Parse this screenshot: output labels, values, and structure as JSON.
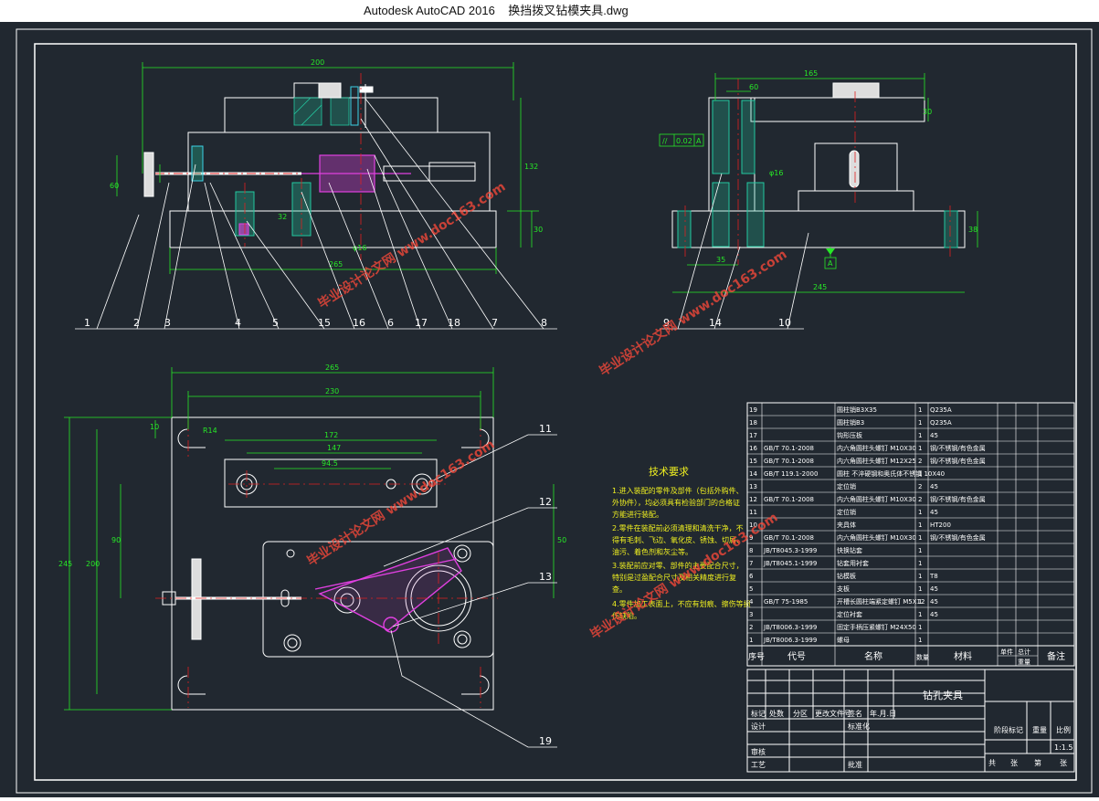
{
  "window": {
    "title": "Autodesk AutoCAD 2016    换挡拨叉钻模夹具.dwg"
  },
  "front_view": {
    "dims": {
      "overall_width": "200",
      "base_width": "265",
      "height": "132",
      "d1": "60",
      "d2": "32",
      "phi": "φ16",
      "v1": "30"
    },
    "balloons": [
      "1",
      "2",
      "3",
      "4",
      "5",
      "15",
      "16",
      "6",
      "17",
      "18",
      "7",
      "8"
    ]
  },
  "side_view": {
    "dims": {
      "width": "165",
      "base": "245",
      "h1": "38",
      "h2": "30",
      "d": "35",
      "e": "60",
      "phi": "φ16"
    },
    "tolerance_frame": {
      "symbol": "//",
      "value": "0.02",
      "datum": "A"
    },
    "datum_label": "A",
    "balloons": [
      "9",
      "14",
      "10"
    ]
  },
  "top_view": {
    "dims": {
      "w265": "265",
      "w230": "230",
      "w172": "172",
      "w147": "147",
      "w94": "94.5",
      "h245": "245",
      "h200": "200",
      "h90": "90",
      "h50": "50",
      "r10": "10",
      "r14": "R14"
    },
    "balloons": [
      "11",
      "12",
      "13",
      "19"
    ]
  },
  "tech_requirements": {
    "title": "技术要求",
    "lines": [
      "1.进入装配的零件及部件（包括外购件、",
      "外协件），均必须具有检验部门的合格证",
      "方能进行装配。",
      "2.零件在装配前必须清理和清洗干净，不",
      "得有毛刺、飞边、氧化皮、锈蚀、切屑、",
      "油污、着色剂和灰尘等。",
      "3.装配前应对零、部件的主要配合尺寸，",
      "特别是过盈配合尺寸及相关精度进行复",
      "查。",
      "4.零件加工表面上，不应有划痕、擦伤等损",
      "伤缺陷。"
    ]
  },
  "bom": {
    "rows": [
      {
        "no": "19",
        "code": "",
        "name": "圆柱销B3X35",
        "qty": "1",
        "material": "Q235A",
        "remark": ""
      },
      {
        "no": "18",
        "code": "",
        "name": "圆柱销B3",
        "qty": "1",
        "material": "Q235A",
        "remark": ""
      },
      {
        "no": "17",
        "code": "",
        "name": "钩形压板",
        "qty": "1",
        "material": "45",
        "remark": ""
      },
      {
        "no": "16",
        "code": "GB/T 70.1-2008",
        "name": "内六角圆柱头螺钉 M10X30",
        "qty": "1",
        "material": "钢/不锈钢/有色金属",
        "remark": ""
      },
      {
        "no": "15",
        "code": "GB/T 70.1-2008",
        "name": "内六角圆柱头螺钉 M12X25",
        "qty": "2",
        "material": "钢/不锈钢/有色金属",
        "remark": ""
      },
      {
        "no": "14",
        "code": "GB/T 119.1-2000",
        "name": "圆柱 不淬硬钢和奥氏体不锈钢 10X40",
        "qty": "1",
        "material": "",
        "remark": ""
      },
      {
        "no": "13",
        "code": "",
        "name": "定位销",
        "qty": "2",
        "material": "45",
        "remark": ""
      },
      {
        "no": "12",
        "code": "GB/T 70.1-2008",
        "name": "内六角圆柱头螺钉 M10X30",
        "qty": "2",
        "material": "钢/不锈钢/有色金属",
        "remark": ""
      },
      {
        "no": "11",
        "code": "",
        "name": "定位销",
        "qty": "1",
        "material": "45",
        "remark": ""
      },
      {
        "no": "10",
        "code": "",
        "name": "夹具体",
        "qty": "1",
        "material": "HT200",
        "remark": ""
      },
      {
        "no": "9",
        "code": "GB/T 70.1-2008",
        "name": "内六角圆柱头螺钉 M10X30",
        "qty": "1",
        "material": "钢/不锈钢/有色金属",
        "remark": ""
      },
      {
        "no": "8",
        "code": "JB/T8045.3-1999",
        "name": "快换钻套",
        "qty": "1",
        "material": "",
        "remark": ""
      },
      {
        "no": "7",
        "code": "JB/T8045.1-1999",
        "name": "钻套用衬套",
        "qty": "1",
        "material": "",
        "remark": ""
      },
      {
        "no": "6",
        "code": "",
        "name": "钻模板",
        "qty": "1",
        "material": "T8",
        "remark": ""
      },
      {
        "no": "5",
        "code": "",
        "name": "支板",
        "qty": "1",
        "material": "45",
        "remark": ""
      },
      {
        "no": "4",
        "code": "GB/T 75-1985",
        "name": "开槽长圆柱端紧定螺钉 M5X12",
        "qty": "1",
        "material": "45",
        "remark": ""
      },
      {
        "no": "3",
        "code": "",
        "name": "定位衬套",
        "qty": "1",
        "material": "45",
        "remark": ""
      },
      {
        "no": "2",
        "code": "JB/T8006.3-1999",
        "name": "固定手柄压紧螺钉 M24X50",
        "qty": "1",
        "material": "",
        "remark": ""
      },
      {
        "no": "1",
        "code": "JB/T8006.3-1999",
        "name": "螺母",
        "qty": "1",
        "material": "",
        "remark": ""
      }
    ],
    "header": {
      "no": "序号",
      "code": "代号",
      "name": "名称",
      "qty": "数量",
      "material": "材料",
      "unit_wt": "单件",
      "total_wt": "总计",
      "weight": "重量",
      "remark": "备注"
    }
  },
  "title_block": {
    "drawing_name": "钻孔夹具",
    "labels": {
      "mark": "标记",
      "count": "处数",
      "zone": "分区",
      "change_doc": "更改文件号",
      "sign": "签名",
      "date": "年.月.日",
      "design": "设计",
      "standard": "标准化",
      "check": "审核",
      "process": "工艺",
      "approve": "批准",
      "stage": "阶段标记",
      "weight": "重量",
      "scale": "比例",
      "sheets_total": "共",
      "sheets_unit": "张",
      "sheet_no": "第",
      "sheet_unit": "张"
    },
    "scale_value": "1:1.5"
  },
  "watermark": {
    "text": "毕业设计论文网 www.doc163.com"
  },
  "colors": {
    "background": "#212830",
    "outline": "#ffffff",
    "dimension": "#27e827",
    "hatch": "#22c9a0",
    "part": "#e040e0",
    "center": "#e02020",
    "cyan": "#3cd2e6",
    "yellow": "#f0f020",
    "watermark": "#ff4a3a"
  }
}
